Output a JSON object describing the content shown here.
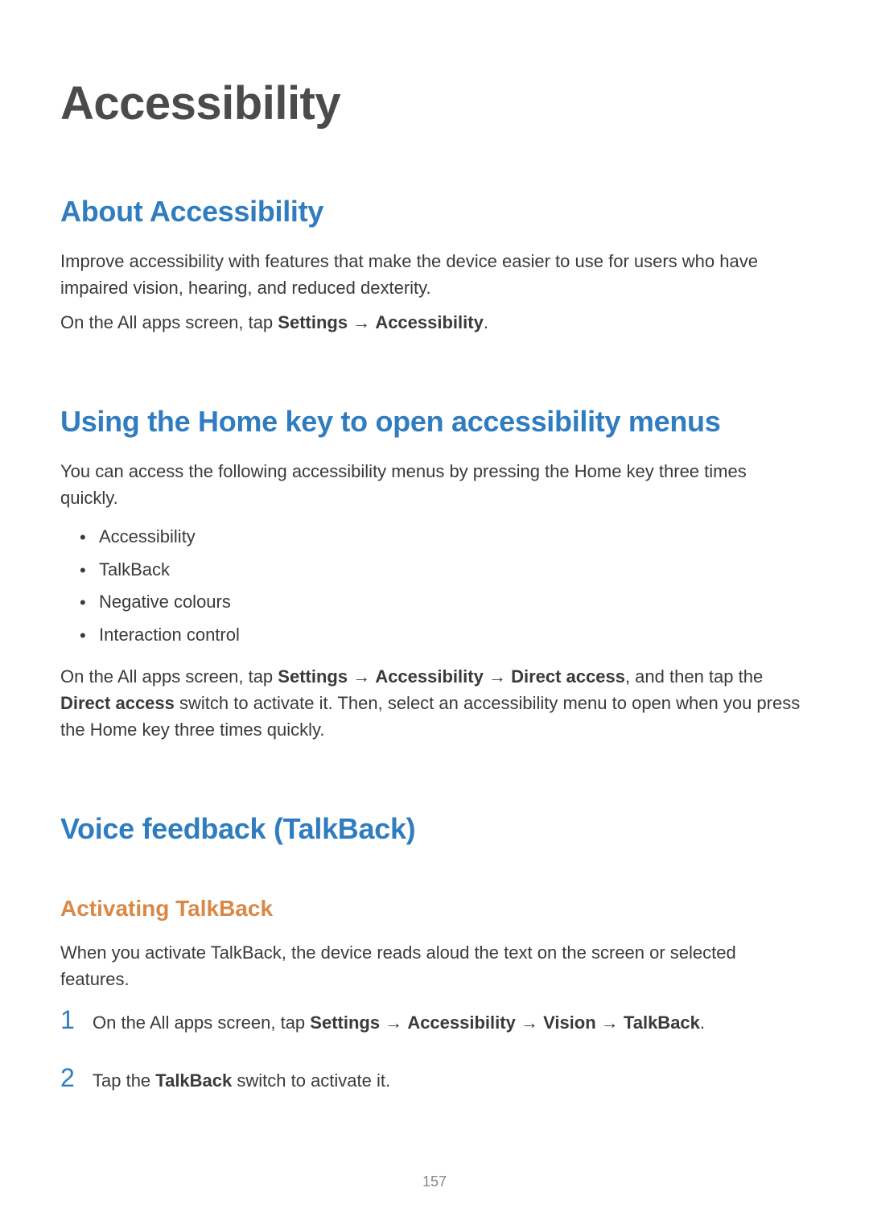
{
  "page_title": "Accessibility",
  "section_about": {
    "heading": "About Accessibility",
    "para1": "Improve accessibility with features that make the device easier to use for users who have impaired vision, hearing, and reduced dexterity.",
    "para2_a": "On the All apps screen, tap ",
    "para2_b_settings": "Settings",
    "para2_arrow": " → ",
    "para2_c_accessibility": "Accessibility",
    "para2_d": "."
  },
  "section_homekey": {
    "heading": "Using the Home key to open accessibility menus",
    "para1": "You can access the following accessibility menus by pressing the Home key three times quickly.",
    "bullets": [
      "Accessibility",
      "TalkBack",
      "Negative colours",
      "Interaction control"
    ],
    "para2_a": "On the All apps screen, tap ",
    "para2_b_settings": "Settings",
    "para2_arrow1": " → ",
    "para2_c_accessibility": "Accessibility",
    "para2_arrow2": " → ",
    "para2_d_direct": "Direct access",
    "para2_e": ", and then tap the ",
    "para2_f_direct": "Direct access",
    "para2_g": " switch to activate it. Then, select an accessibility menu to open when you press the Home key three times quickly."
  },
  "section_voice": {
    "heading": "Voice feedback (TalkBack)",
    "subheading": "Activating TalkBack",
    "para1": "When you activate TalkBack, the device reads aloud the text on the screen or selected features.",
    "steps": {
      "1": {
        "num": "1",
        "a": "On the All apps screen, tap ",
        "b_settings": "Settings",
        "arrow1": " → ",
        "c_accessibility": "Accessibility",
        "arrow2": " → ",
        "d_vision": "Vision",
        "arrow3": " → ",
        "e_talkback": "TalkBack",
        "f": "."
      },
      "2": {
        "num": "2",
        "a": "Tap the ",
        "b_talkback": "TalkBack",
        "c": " switch to activate it."
      }
    }
  },
  "page_number": "157"
}
